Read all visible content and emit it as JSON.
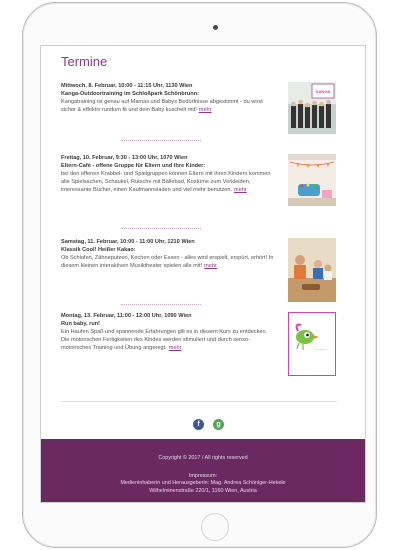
{
  "page_title": "Termine",
  "events": [
    {
      "date": "Mittwoch, 8. Februar, 10:00 - 11:15 Uhr, 1130 Wien",
      "title": "Kanga-Outdoortraining im Schloßpark Schönbrunn:",
      "description": "Kangatraining ist genau auf Mamas und Babys Bedürfnisse abgestimmt - du wirst sicher & effektiv rundum fit und dein Baby kuschelt mit!",
      "more": "mehr",
      "image": "kanga-training-photo"
    },
    {
      "date": "Freitag, 10. Februar, 9:30 - 13:00 Uhr, 1070 Wien",
      "title": "Eltern-Café - offene Gruppe für Eltern und ihre Kinder:",
      "description": "bei den offenen Krabbel- und Spielgruppen können Eltern mit ihren Kindern kommen alle Spielsachen, Schaukel, Rutsche mit Bällebad, Kostüme zum Verkleiden, interessante Bücher, einen Kaufmannsladen und viel mehr benutzen.",
      "more": "mehr",
      "image": "playroom-photo"
    },
    {
      "date": "Samstag, 11. Februar, 10:00 - 11:00 Uhr, 1210 Wien",
      "title": "Klassik Cool! Heißer Kakao:",
      "description": "Ob Schlafen, Zähneputzen, Kochen oder Essen - alles wird erspielt, erspürt, erhört! In diesem kleinen interaktiven Musiktheater spielen alle mit!",
      "more": "mehr",
      "image": "music-theater-photo"
    },
    {
      "date": "Montag, 13. Februar, 11:00 - 12:00 Uhr, 1090 Wien",
      "title": "Run baby, run!",
      "description": "Ein Haufen Spaß und spannende Erfahrungen gilt es in diesem Kurs zu entdecken. Die motorischen Fertigkeiten des Kindes werden stimuliert und durch senso-motorisches Training und Übung angeregt.",
      "more": "mehr",
      "image": "bird-logo"
    }
  ],
  "social": {
    "facebook": "f",
    "google": "g"
  },
  "footer": {
    "copyright": "Copyright © 2017 / All rights reserved",
    "impressum": "Impressum:",
    "publisher": "Medieninhaberin und Herausgeberin: Mag. Andrea Schöniger-Hekele",
    "address": "Wilhelminenstraße 220/1, 1160 Wien, Austria"
  },
  "colors": {
    "accent": "#8d3a8a",
    "footer_bg": "#6a2a61"
  }
}
